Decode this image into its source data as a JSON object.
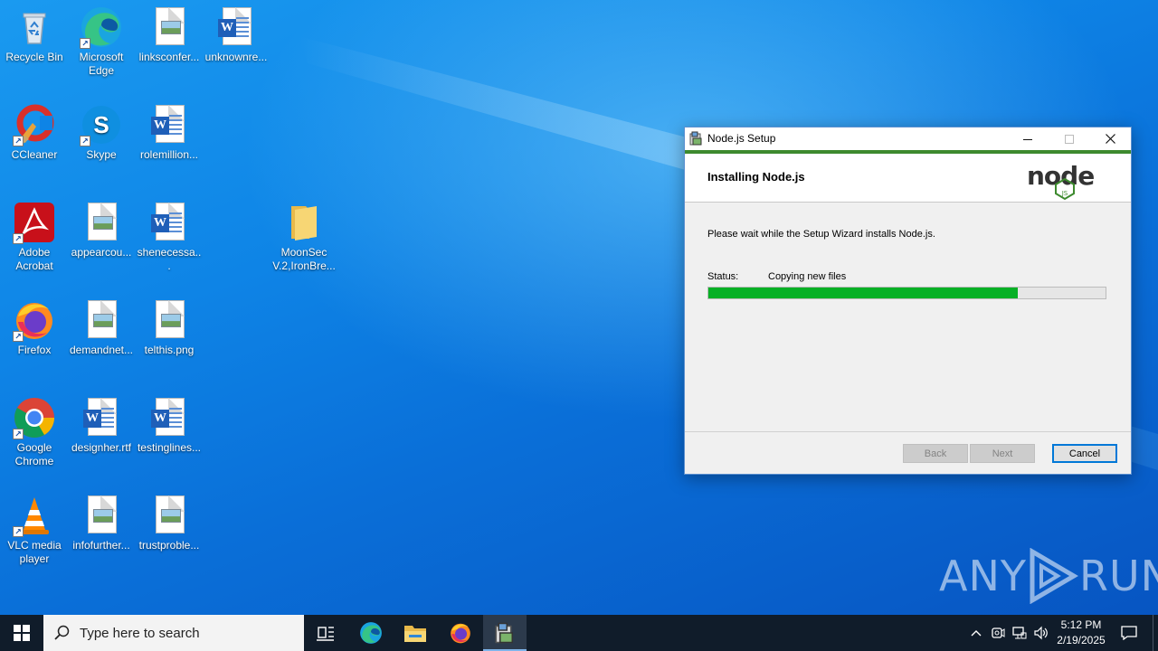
{
  "desktop": {
    "icons": [
      {
        "label": "Recycle Bin"
      },
      {
        "label": "Microsoft Edge"
      },
      {
        "label": "linksconfer..."
      },
      {
        "label": "unknownre..."
      },
      {
        "label": "CCleaner"
      },
      {
        "label": "Skype"
      },
      {
        "label": "rolemillion..."
      },
      {
        "label": "Adobe Acrobat"
      },
      {
        "label": "appearcou..."
      },
      {
        "label": "shenecessa..."
      },
      {
        "label": "MoonSec V.2,IronBre..."
      },
      {
        "label": "Firefox"
      },
      {
        "label": "demandnet..."
      },
      {
        "label": "telthis.png"
      },
      {
        "label": "Google Chrome"
      },
      {
        "label": "designher.rtf"
      },
      {
        "label": "testinglines..."
      },
      {
        "label": "VLC media player"
      },
      {
        "label": "infofurther..."
      },
      {
        "label": "trustproble..."
      }
    ]
  },
  "setup_window": {
    "title": "Node.js Setup",
    "header_title": "Installing Node.js",
    "message": "Please wait while the Setup Wizard installs Node.js.",
    "status_label": "Status:",
    "status_value": "Copying new files",
    "progress_fraction": 0.78,
    "buttons": {
      "back": "Back",
      "next": "Next",
      "cancel": "Cancel"
    },
    "logo_text": "node",
    "logo_sub": "JS"
  },
  "watermark": {
    "left": "ANY",
    "right": "RUN"
  },
  "taskbar": {
    "search_placeholder": "Type here to search",
    "time": "5:12 PM",
    "date": "2/19/2025"
  },
  "colors": {
    "progress_fill": "#06b025",
    "accent": "#0078d7",
    "node_green": "#3d8a2e",
    "taskbar": "#101c2a"
  }
}
